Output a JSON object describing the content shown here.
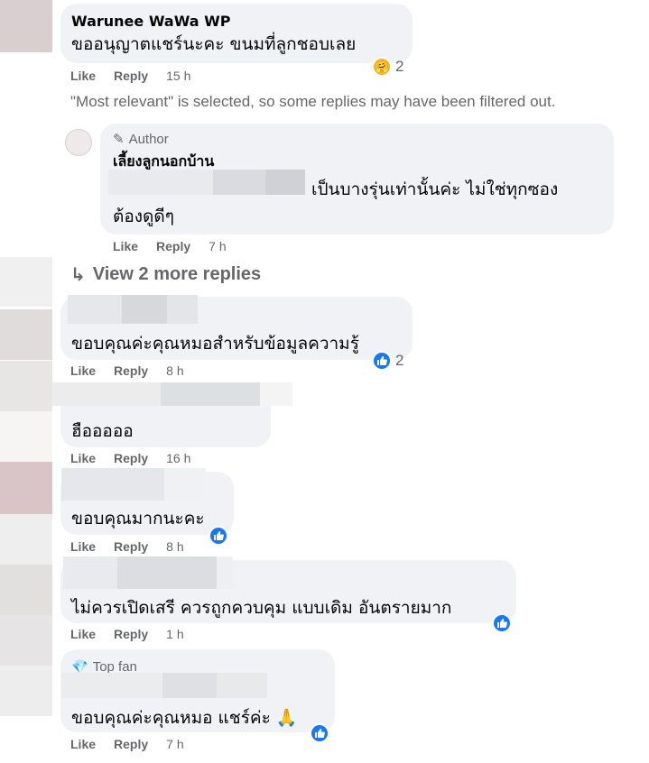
{
  "comments": [
    {
      "name": "Warunee WaWa WP",
      "text": "ขออนุญาตแชร์นะคะ ขนมที่ลูกชอบเลย",
      "like": "Like",
      "reply": "Reply",
      "time": "15 h",
      "reaction_count": "2"
    },
    {
      "author_tag": "Author",
      "name": "เลี้ยงลูกนอกบ้าน",
      "text_line1": "เป็นบางรุ่นเท่านั้นค่ะ ไม่ใช่ทุกซอง",
      "text_line2": "ต้องดูดีๆ",
      "like": "Like",
      "reply": "Reply",
      "time": "7 h"
    },
    {
      "text": "ขอบคุณค่ะคุณหมอสำหรับข้อมูลความรู้",
      "like": "Like",
      "reply": "Reply",
      "time": "8 h",
      "reaction_count": "2"
    },
    {
      "text": "ฮือออออ",
      "like": "Like",
      "reply": "Reply",
      "time": "16 h"
    },
    {
      "text": "ขอบคุณมากนะคะ",
      "like": "Like",
      "reply": "Reply",
      "time": "8 h"
    },
    {
      "text": "ไม่ควรเปิดเสรี ควรถูกควบคุม แบบเดิม อันตรายมาก",
      "like": "Like",
      "reply": "Reply",
      "time": "1 h"
    },
    {
      "fan_tag": "Top fan",
      "text": "ขอบคุณค่ะคุณหมอ แชร์ค่ะ 🙏",
      "like": "Like",
      "reply": "Reply",
      "time": "7 h"
    }
  ],
  "filter_note": "\"Most relevant\" is selected, so some replies may have been filtered out.",
  "view_more": "View 2 more replies",
  "colors": {
    "like_blue": "#1877f2",
    "bubble": "#f0f2f5",
    "meta": "#65676b"
  }
}
